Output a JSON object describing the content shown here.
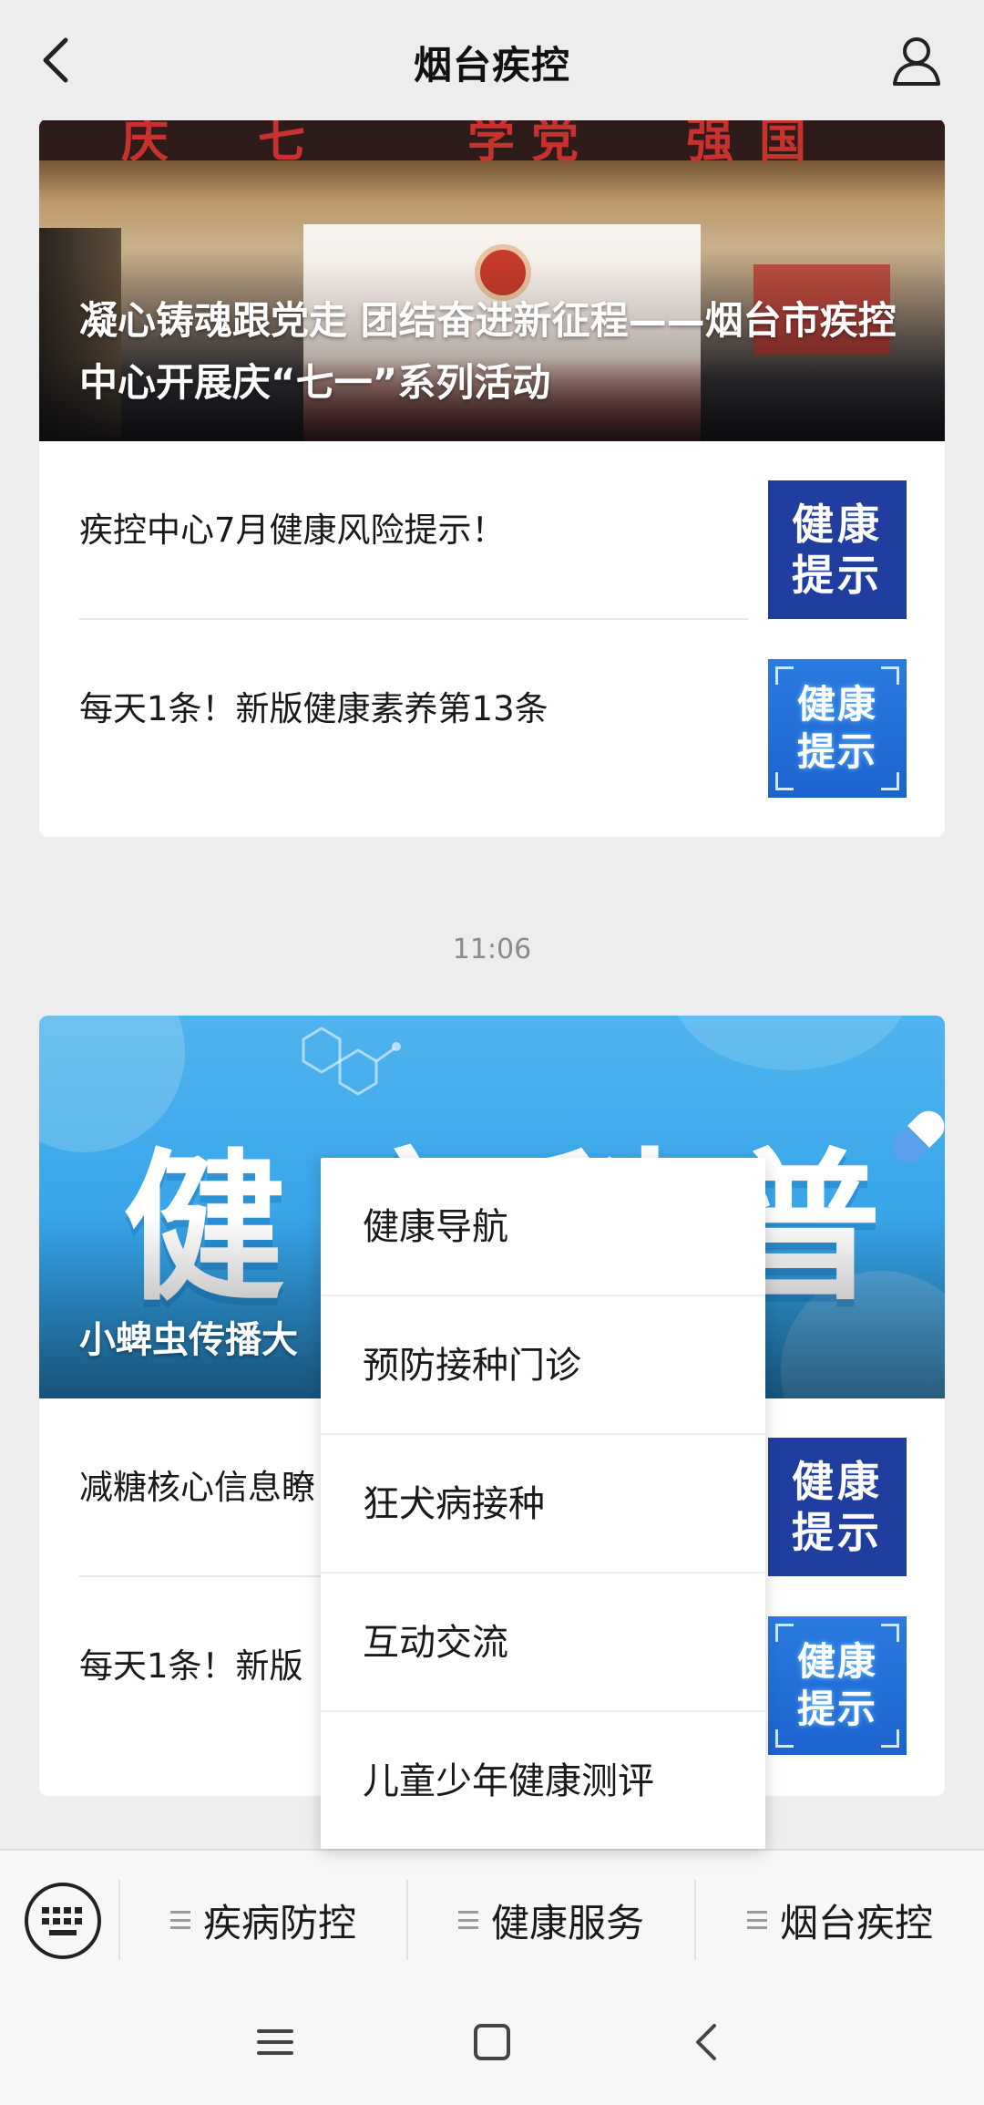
{
  "header": {
    "title": "烟台疾控",
    "back_icon": "back-arrow-icon",
    "user_icon": "user-icon"
  },
  "messages": [
    {
      "cover": {
        "headline": "凝心铸魂跟党走 团结奋进新征程——烟台市疾控中心开展庆“七一”系列活动"
      },
      "items": [
        {
          "title": "疾控中心7月健康风险提示！",
          "thumb_text": "健康提示"
        },
        {
          "title": "每天1条！新版健康素养第13条",
          "thumb_text": "健康提示"
        }
      ]
    },
    {
      "time": "11:06",
      "cover": {
        "image_text": "健康科普",
        "headline": "小蜱虫传播大"
      },
      "items": [
        {
          "title": "减糖核心信息瞭",
          "thumb_text": "健康提示"
        },
        {
          "title": "每天1条！新版",
          "thumb_text": "健康提示"
        }
      ]
    }
  ],
  "popup_menu": {
    "options": [
      "健康导航",
      "预防接种门诊",
      "狂犬病接种",
      "互动交流",
      "儿童少年健康测评"
    ]
  },
  "bottom_menu": {
    "keyboard_icon": "keyboard-icon",
    "tabs": [
      "疾病防控",
      "健康服务",
      "烟台疾控"
    ]
  },
  "system_nav": {
    "icons": [
      "menu-icon",
      "home-icon",
      "back-icon"
    ]
  },
  "colors": {
    "background": "#ededed",
    "card": "#ffffff",
    "thumb_navy": "#1f3ea0",
    "thumb_blue": "#2a7be0",
    "banner_blue": "#3aa7ea"
  }
}
